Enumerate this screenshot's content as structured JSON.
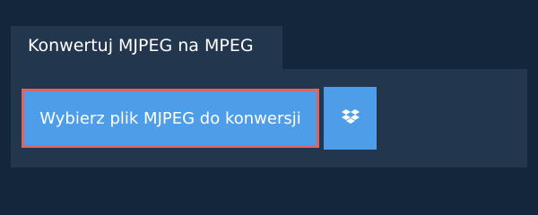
{
  "tab": {
    "title": "Konwertuj MJPEG na MPEG"
  },
  "actions": {
    "upload_label": "Wybierz plik MJPEG do konwersji",
    "dropbox_icon": "dropbox-icon"
  },
  "colors": {
    "background": "#14263b",
    "panel": "#22364e",
    "button": "#4e9de9",
    "button_outline": "#e06360",
    "text": "#ffffff"
  }
}
